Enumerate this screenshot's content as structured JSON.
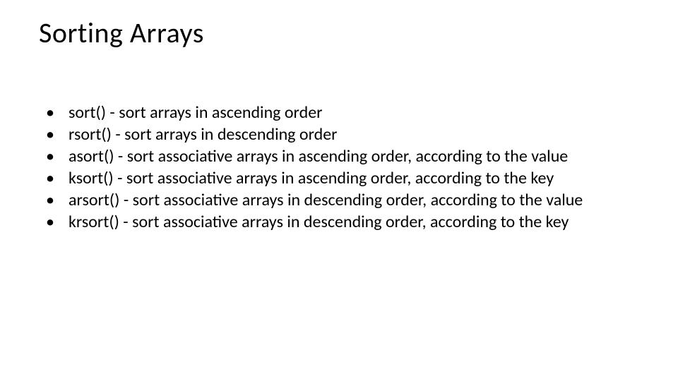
{
  "slide": {
    "title": "Sorting Arrays",
    "items": [
      "sort() - sort arrays in ascending order",
      "rsort() - sort arrays in descending order",
      "asort() - sort associative arrays in ascending order, according to the value",
      "ksort() - sort associative arrays in ascending order, according to the key",
      "arsort() - sort associative arrays in descending order, according to the value",
      "krsort() - sort associative arrays in descending order, according to the key"
    ]
  }
}
